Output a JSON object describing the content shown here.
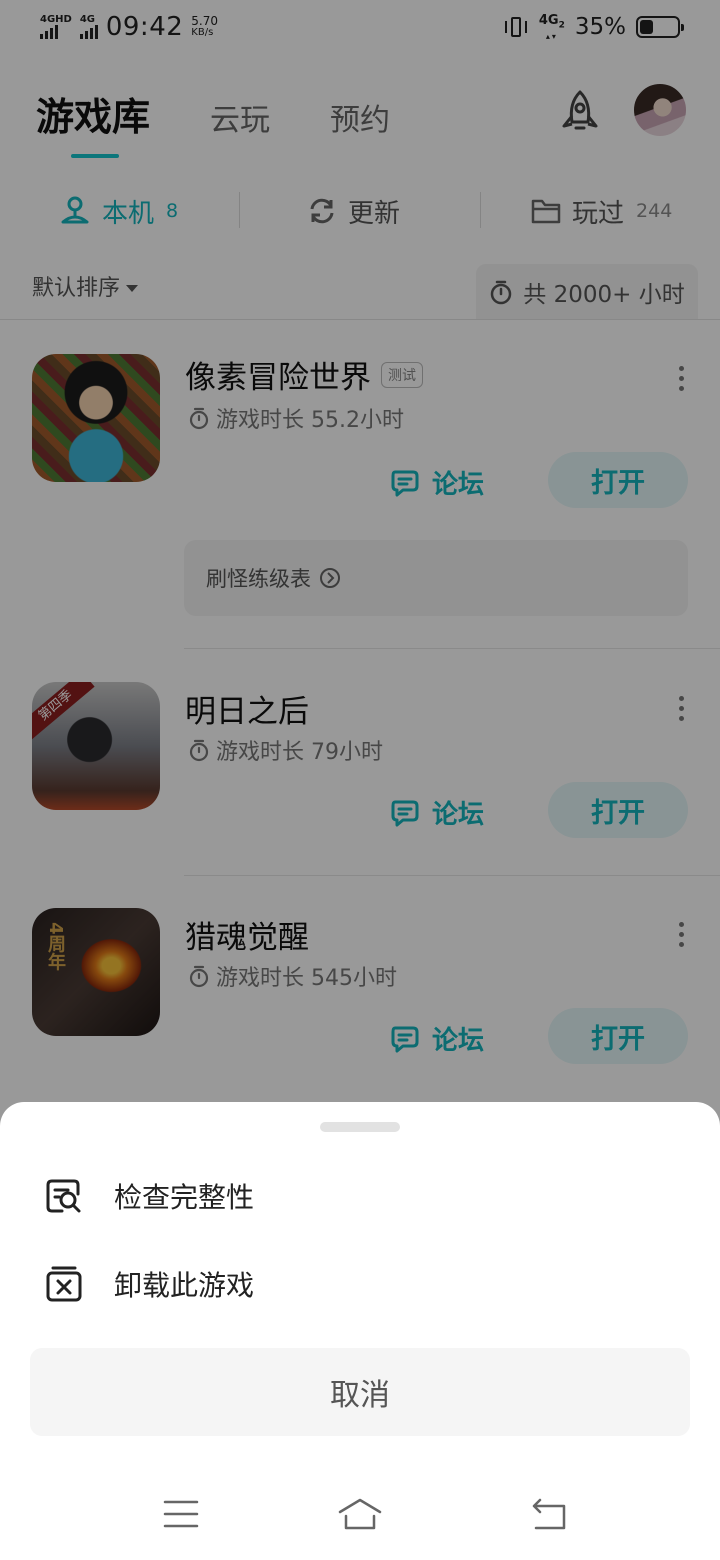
{
  "status_bar": {
    "sim1": "4GHD",
    "sim2": "4G",
    "time": "09:42",
    "speed_value": "5.70",
    "speed_unit": "KB/s",
    "network": "4G",
    "network_sub": "2",
    "battery": "35%",
    "battery_level": 0.35
  },
  "header": {
    "tabs": [
      {
        "label": "游戏库",
        "active": true
      },
      {
        "label": "云玩",
        "active": false
      },
      {
        "label": "预约",
        "active": false
      }
    ]
  },
  "subtabs": [
    {
      "label": "本机",
      "count": "8",
      "icon": "device-icon",
      "active": true
    },
    {
      "label": "更新",
      "count": "",
      "icon": "refresh-icon",
      "active": false
    },
    {
      "label": "玩过",
      "count": "244",
      "icon": "folder-icon",
      "active": false
    }
  ],
  "sort": {
    "label": "默认排序"
  },
  "total_time": "共 2000+ 小时",
  "games": [
    {
      "name": "像素冒险世界",
      "tag": "测试",
      "playtime": "游戏时长 55.2小时",
      "forum_label": "论坛",
      "open_label": "打开",
      "guide": "刷怪练级表"
    },
    {
      "name": "明日之后",
      "icon_badge": "第四季",
      "playtime": "游戏时长 79小时",
      "forum_label": "论坛",
      "open_label": "打开"
    },
    {
      "name": "猎魂觉醒",
      "icon_badge": "4周年",
      "playtime": "游戏时长 545小时",
      "forum_label": "论坛",
      "open_label": "打开"
    }
  ],
  "sheet": {
    "items": [
      {
        "label": "检查完整性",
        "icon": "check-integrity-icon"
      },
      {
        "label": "卸载此游戏",
        "icon": "uninstall-icon"
      }
    ],
    "cancel": "取消"
  },
  "navbar": [
    "menu-icon",
    "home-icon",
    "back-icon"
  ],
  "colors": {
    "accent": "#15b4bd",
    "overlay": "rgba(0,0,0,0.4)"
  }
}
